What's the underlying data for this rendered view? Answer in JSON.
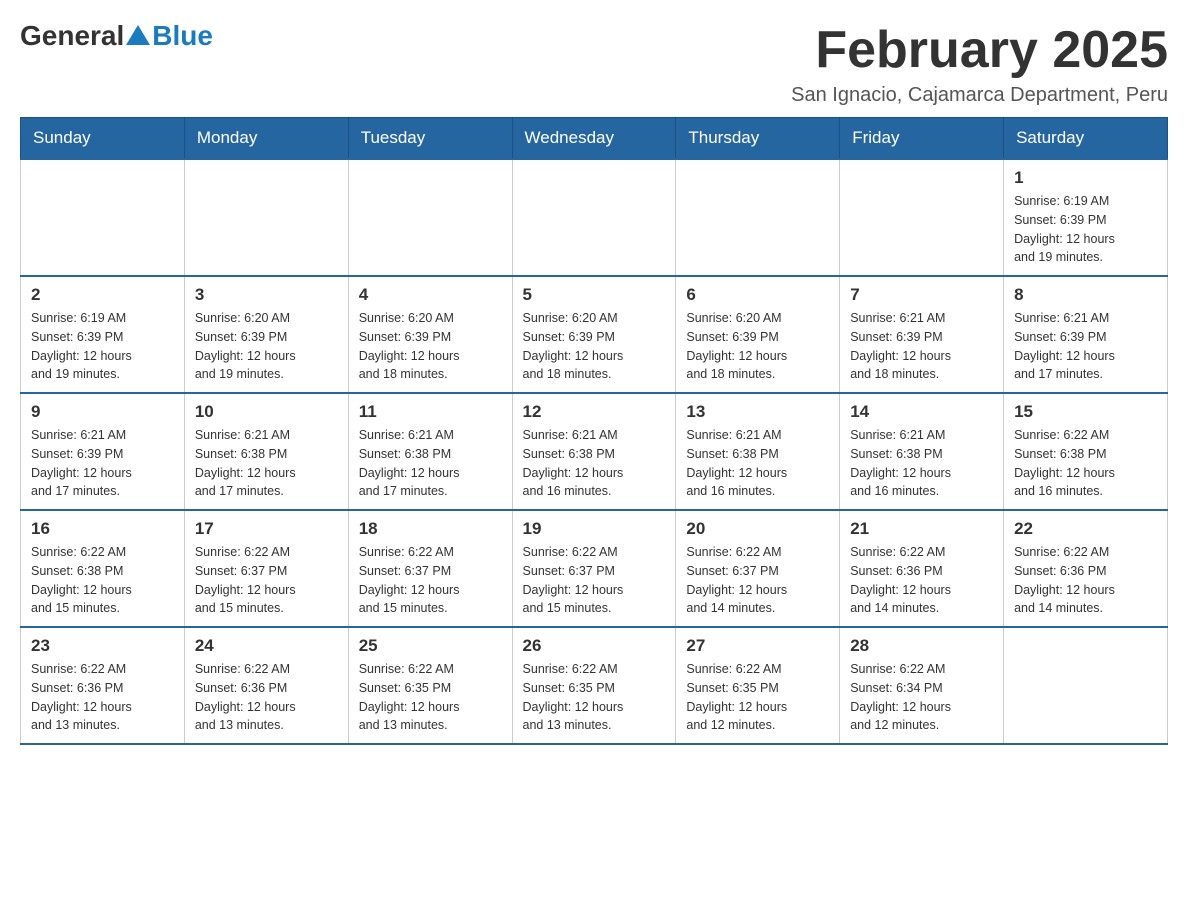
{
  "logo": {
    "general": "General",
    "blue": "Blue"
  },
  "title": "February 2025",
  "subtitle": "San Ignacio, Cajamarca Department, Peru",
  "weekdays": [
    "Sunday",
    "Monday",
    "Tuesday",
    "Wednesday",
    "Thursday",
    "Friday",
    "Saturday"
  ],
  "weeks": [
    [
      {
        "day": "",
        "info": ""
      },
      {
        "day": "",
        "info": ""
      },
      {
        "day": "",
        "info": ""
      },
      {
        "day": "",
        "info": ""
      },
      {
        "day": "",
        "info": ""
      },
      {
        "day": "",
        "info": ""
      },
      {
        "day": "1",
        "info": "Sunrise: 6:19 AM\nSunset: 6:39 PM\nDaylight: 12 hours\nand 19 minutes."
      }
    ],
    [
      {
        "day": "2",
        "info": "Sunrise: 6:19 AM\nSunset: 6:39 PM\nDaylight: 12 hours\nand 19 minutes."
      },
      {
        "day": "3",
        "info": "Sunrise: 6:20 AM\nSunset: 6:39 PM\nDaylight: 12 hours\nand 19 minutes."
      },
      {
        "day": "4",
        "info": "Sunrise: 6:20 AM\nSunset: 6:39 PM\nDaylight: 12 hours\nand 18 minutes."
      },
      {
        "day": "5",
        "info": "Sunrise: 6:20 AM\nSunset: 6:39 PM\nDaylight: 12 hours\nand 18 minutes."
      },
      {
        "day": "6",
        "info": "Sunrise: 6:20 AM\nSunset: 6:39 PM\nDaylight: 12 hours\nand 18 minutes."
      },
      {
        "day": "7",
        "info": "Sunrise: 6:21 AM\nSunset: 6:39 PM\nDaylight: 12 hours\nand 18 minutes."
      },
      {
        "day": "8",
        "info": "Sunrise: 6:21 AM\nSunset: 6:39 PM\nDaylight: 12 hours\nand 17 minutes."
      }
    ],
    [
      {
        "day": "9",
        "info": "Sunrise: 6:21 AM\nSunset: 6:39 PM\nDaylight: 12 hours\nand 17 minutes."
      },
      {
        "day": "10",
        "info": "Sunrise: 6:21 AM\nSunset: 6:38 PM\nDaylight: 12 hours\nand 17 minutes."
      },
      {
        "day": "11",
        "info": "Sunrise: 6:21 AM\nSunset: 6:38 PM\nDaylight: 12 hours\nand 17 minutes."
      },
      {
        "day": "12",
        "info": "Sunrise: 6:21 AM\nSunset: 6:38 PM\nDaylight: 12 hours\nand 16 minutes."
      },
      {
        "day": "13",
        "info": "Sunrise: 6:21 AM\nSunset: 6:38 PM\nDaylight: 12 hours\nand 16 minutes."
      },
      {
        "day": "14",
        "info": "Sunrise: 6:21 AM\nSunset: 6:38 PM\nDaylight: 12 hours\nand 16 minutes."
      },
      {
        "day": "15",
        "info": "Sunrise: 6:22 AM\nSunset: 6:38 PM\nDaylight: 12 hours\nand 16 minutes."
      }
    ],
    [
      {
        "day": "16",
        "info": "Sunrise: 6:22 AM\nSunset: 6:38 PM\nDaylight: 12 hours\nand 15 minutes."
      },
      {
        "day": "17",
        "info": "Sunrise: 6:22 AM\nSunset: 6:37 PM\nDaylight: 12 hours\nand 15 minutes."
      },
      {
        "day": "18",
        "info": "Sunrise: 6:22 AM\nSunset: 6:37 PM\nDaylight: 12 hours\nand 15 minutes."
      },
      {
        "day": "19",
        "info": "Sunrise: 6:22 AM\nSunset: 6:37 PM\nDaylight: 12 hours\nand 15 minutes."
      },
      {
        "day": "20",
        "info": "Sunrise: 6:22 AM\nSunset: 6:37 PM\nDaylight: 12 hours\nand 14 minutes."
      },
      {
        "day": "21",
        "info": "Sunrise: 6:22 AM\nSunset: 6:36 PM\nDaylight: 12 hours\nand 14 minutes."
      },
      {
        "day": "22",
        "info": "Sunrise: 6:22 AM\nSunset: 6:36 PM\nDaylight: 12 hours\nand 14 minutes."
      }
    ],
    [
      {
        "day": "23",
        "info": "Sunrise: 6:22 AM\nSunset: 6:36 PM\nDaylight: 12 hours\nand 13 minutes."
      },
      {
        "day": "24",
        "info": "Sunrise: 6:22 AM\nSunset: 6:36 PM\nDaylight: 12 hours\nand 13 minutes."
      },
      {
        "day": "25",
        "info": "Sunrise: 6:22 AM\nSunset: 6:35 PM\nDaylight: 12 hours\nand 13 minutes."
      },
      {
        "day": "26",
        "info": "Sunrise: 6:22 AM\nSunset: 6:35 PM\nDaylight: 12 hours\nand 13 minutes."
      },
      {
        "day": "27",
        "info": "Sunrise: 6:22 AM\nSunset: 6:35 PM\nDaylight: 12 hours\nand 12 minutes."
      },
      {
        "day": "28",
        "info": "Sunrise: 6:22 AM\nSunset: 6:34 PM\nDaylight: 12 hours\nand 12 minutes."
      },
      {
        "day": "",
        "info": ""
      }
    ]
  ]
}
